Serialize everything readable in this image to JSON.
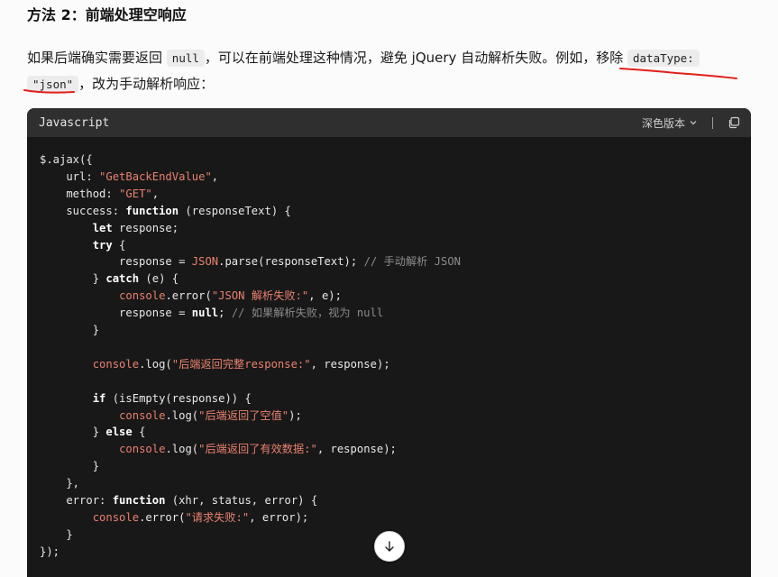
{
  "heading": "方法 2：前端处理空响应",
  "paragraph": {
    "part1": "如果后端确实需要返回",
    "code1": "null",
    "part2": "，可以在前端处理这种情况，避免 jQuery 自动解析失败。例如，",
    "emph": "移除",
    "code2a": "dataType:",
    "code2b": "\"json\"",
    "part3": "，改为手动解析响应："
  },
  "code_block": {
    "language": "Javascript",
    "theme_button": "深色版本",
    "lines": [
      [
        [
          "t",
          "$.ajax({"
        ]
      ],
      [
        [
          "t",
          "    url: "
        ],
        [
          "s",
          "\"GetBackEndValue\""
        ],
        [
          "t",
          ","
        ]
      ],
      [
        [
          "t",
          "    method: "
        ],
        [
          "s",
          "\"GET\""
        ],
        [
          "t",
          ","
        ]
      ],
      [
        [
          "t",
          "    success: "
        ],
        [
          "k",
          "function"
        ],
        [
          "t",
          " (responseText) {"
        ]
      ],
      [
        [
          "t",
          "        "
        ],
        [
          "k",
          "let"
        ],
        [
          "t",
          " response;"
        ]
      ],
      [
        [
          "t",
          "        "
        ],
        [
          "k",
          "try"
        ],
        [
          "t",
          " {"
        ]
      ],
      [
        [
          "t",
          "            response = "
        ],
        [
          "o",
          "JSON"
        ],
        [
          "t",
          ".parse(responseText); "
        ],
        [
          "c",
          "// 手动解析 JSON"
        ]
      ],
      [
        [
          "t",
          "        } "
        ],
        [
          "k",
          "catch"
        ],
        [
          "t",
          " (e) {"
        ]
      ],
      [
        [
          "t",
          "            "
        ],
        [
          "o",
          "console"
        ],
        [
          "t",
          ".error("
        ],
        [
          "s",
          "\"JSON 解析失败:\""
        ],
        [
          "t",
          ", e);"
        ]
      ],
      [
        [
          "t",
          "            response = "
        ],
        [
          "k",
          "null"
        ],
        [
          "t",
          "; "
        ],
        [
          "c",
          "// 如果解析失败，视为 null"
        ]
      ],
      [
        [
          "t",
          "        }"
        ]
      ],
      [
        [
          "t",
          ""
        ]
      ],
      [
        [
          "t",
          "        "
        ],
        [
          "o",
          "console"
        ],
        [
          "t",
          ".log("
        ],
        [
          "s",
          "\"后端返回完整response:\""
        ],
        [
          "t",
          ", response);"
        ]
      ],
      [
        [
          "t",
          ""
        ]
      ],
      [
        [
          "t",
          "        "
        ],
        [
          "k",
          "if"
        ],
        [
          "t",
          " (isEmpty(response)) {"
        ]
      ],
      [
        [
          "t",
          "            "
        ],
        [
          "o",
          "console"
        ],
        [
          "t",
          ".log("
        ],
        [
          "s",
          "\"后端返回了空值\""
        ],
        [
          "t",
          ");"
        ]
      ],
      [
        [
          "t",
          "        } "
        ],
        [
          "k",
          "else"
        ],
        [
          "t",
          " {"
        ]
      ],
      [
        [
          "t",
          "            "
        ],
        [
          "o",
          "console"
        ],
        [
          "t",
          ".log("
        ],
        [
          "s",
          "\"后端返回了有效数据:\""
        ],
        [
          "t",
          ", response);"
        ]
      ],
      [
        [
          "t",
          "        }"
        ]
      ],
      [
        [
          "t",
          "    },"
        ]
      ],
      [
        [
          "t",
          "    error: "
        ],
        [
          "k",
          "function"
        ],
        [
          "t",
          " (xhr, status, error) {"
        ]
      ],
      [
        [
          "t",
          "        "
        ],
        [
          "o",
          "console"
        ],
        [
          "t",
          ".error("
        ],
        [
          "s",
          "\"请求失败:\""
        ],
        [
          "t",
          ", error);"
        ]
      ],
      [
        [
          "t",
          "    }"
        ]
      ],
      [
        [
          "t",
          "});"
        ]
      ]
    ]
  },
  "icons": {
    "theme_chevron": "chevron-down-icon",
    "copy": "copy-icon",
    "scroll_down": "arrow-down-icon"
  },
  "colors": {
    "code_bg": "#181818",
    "header_bg": "#2f2f2f",
    "string": "#e8816f",
    "comment": "#8b8b8b",
    "underline": "#e0201a"
  }
}
